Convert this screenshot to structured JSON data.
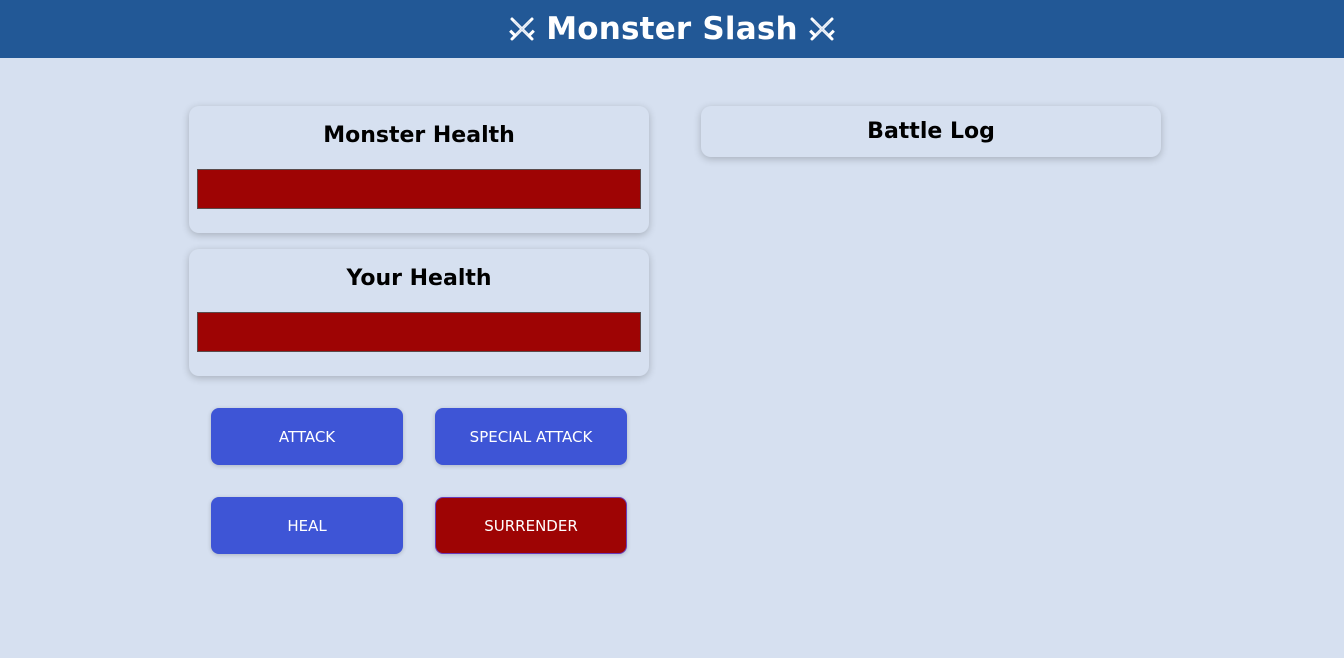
{
  "header": {
    "title": "Monster Slash",
    "left_icon": "crossed-swords-icon",
    "right_icon": "crossed-swords-icon"
  },
  "monster": {
    "label": "Monster Health",
    "health_percent": 100
  },
  "player": {
    "label": "Your Health",
    "health_percent": 100
  },
  "controls": {
    "attack": "ATTACK",
    "special_attack": "SPECIAL ATTACK",
    "heal": "HEAL",
    "surrender": "SURRENDER"
  },
  "log": {
    "title": "Battle Log"
  },
  "colors": {
    "header": "#225896",
    "background": "#d6e0f0",
    "health_bar": "#9e0404",
    "button": "#3e55d6",
    "surrender_button": "#9e0404"
  }
}
